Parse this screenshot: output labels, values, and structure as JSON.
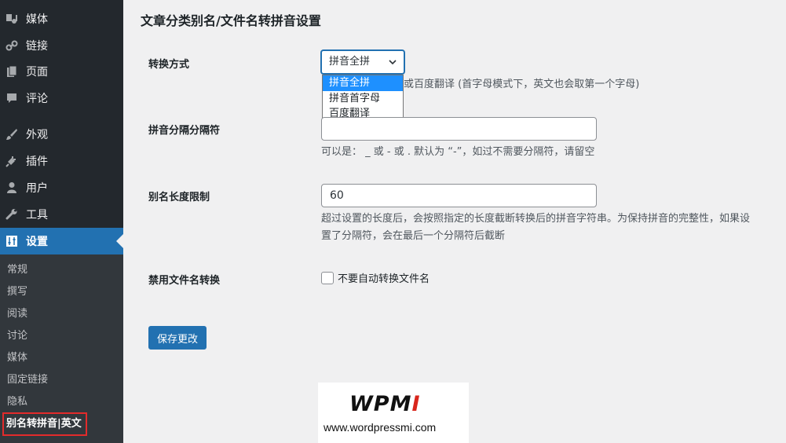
{
  "sidebar": {
    "menu": [
      {
        "label": "媒体",
        "icon": "media-icon"
      },
      {
        "label": "链接",
        "icon": "link-icon"
      },
      {
        "label": "页面",
        "icon": "page-icon"
      },
      {
        "label": "评论",
        "icon": "comment-icon"
      },
      {
        "label": "外观",
        "icon": "brush-icon"
      },
      {
        "label": "插件",
        "icon": "plugin-icon"
      },
      {
        "label": "用户",
        "icon": "user-icon"
      },
      {
        "label": "工具",
        "icon": "wrench-icon"
      },
      {
        "label": "设置",
        "icon": "settings-icon",
        "active": true
      }
    ],
    "submenu": [
      "常规",
      "撰写",
      "阅读",
      "讨论",
      "媒体",
      "固定链接",
      "隐私",
      "别名转拼音|英文"
    ],
    "current_submenu": "别名转拼音|英文"
  },
  "page": {
    "title": "文章分类别名/文件名转拼音设置"
  },
  "fields": {
    "convert_mode": {
      "label": "转换方式",
      "selected": "拼音全拼",
      "options": [
        "拼音全拼",
        "拼音首字母",
        "百度翻译"
      ],
      "desc_partial": "或百度翻译 (首字母模式下，英文也会取第一个字母)"
    },
    "separator": {
      "label": "拼音分隔分隔符",
      "value": "",
      "desc": "可以是： _ 或 - 或 .   默认为 “-”，如过不需要分隔符，请留空"
    },
    "length_limit": {
      "label": "别名长度限制",
      "value": "60",
      "desc_line1": "超过设置的长度后，会按照指定的长度截断转换后的拼音字符串。为保持拼音的完整性，如果设",
      "desc_line2": "置了分隔符，会在最后一个分隔符后截断"
    },
    "disable_filename": {
      "label": "禁用文件名转换",
      "checkbox_label": "不要自动转换文件名",
      "checked": false
    }
  },
  "save_button": "保存更改",
  "watermark": {
    "logo_black": "WPM",
    "logo_red": "I",
    "url": "www.wordpressmi.com"
  },
  "colors": {
    "sidebar_bg": "#23282d",
    "submenu_bg": "#32373c",
    "accent": "#2271b1",
    "highlight_box": "#e32b2b",
    "option_selected": "#1e90ff"
  }
}
